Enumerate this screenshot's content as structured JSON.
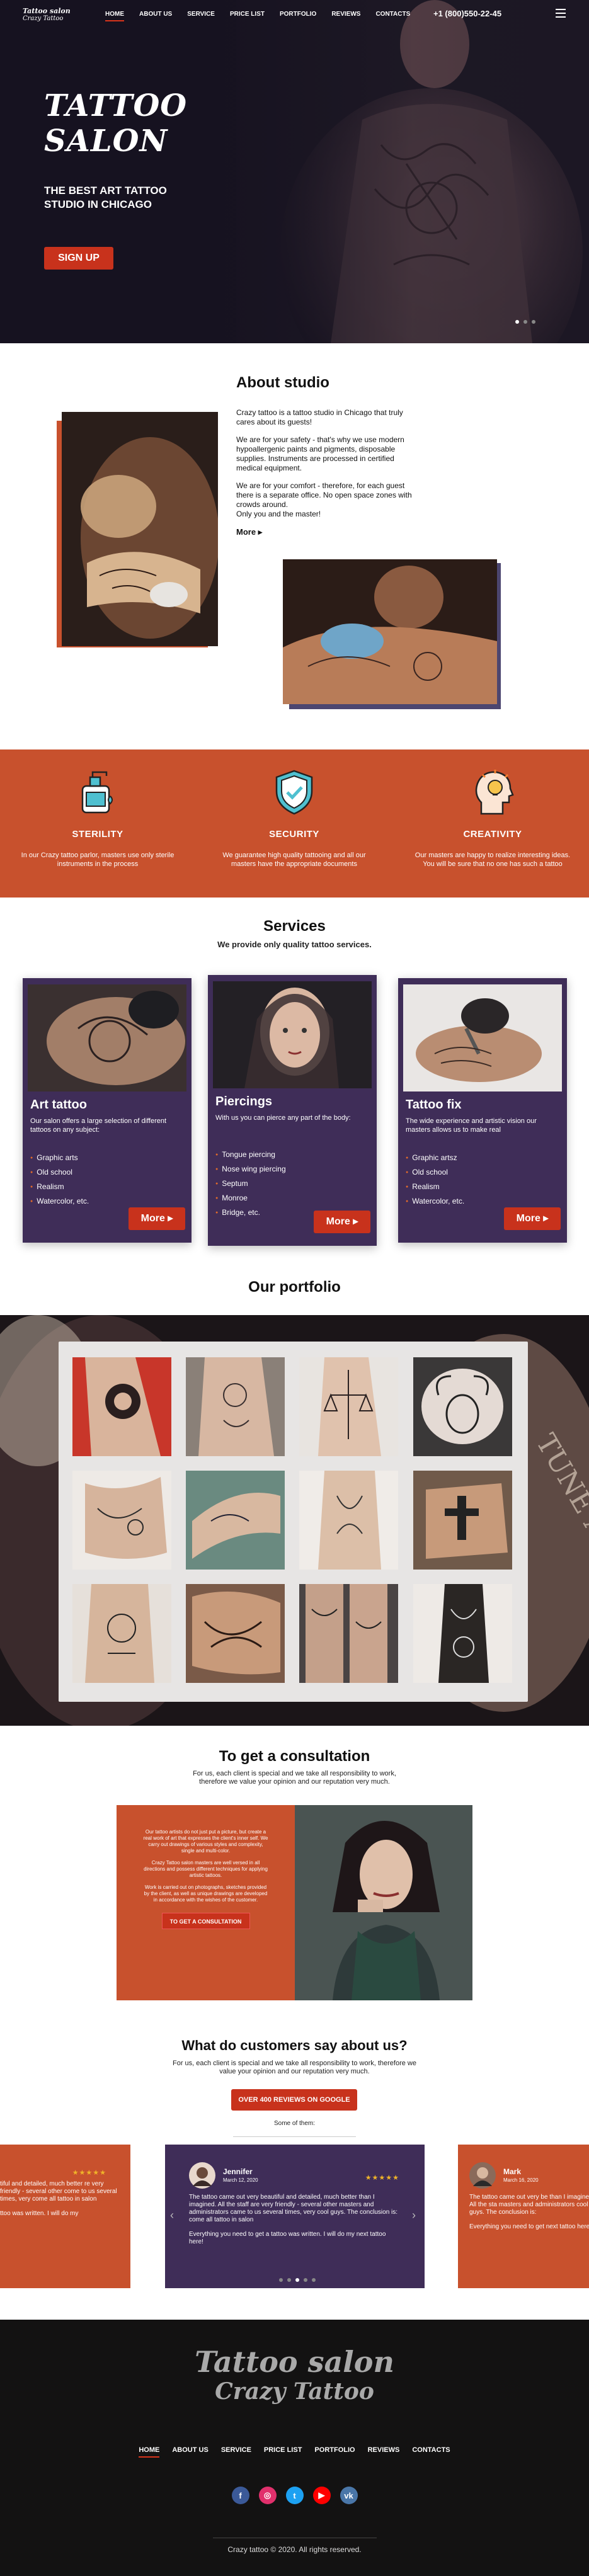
{
  "nav": {
    "logo_line1": "Tattoo salon",
    "logo_line2": "Crazy Tattoo",
    "links": [
      "HOME",
      "ABOUT US",
      "SERVICE",
      "PRICE LIST",
      "PORTFOLIO",
      "REVIEWS",
      "CONTACTS"
    ],
    "phone": "+1 (800)550-22-45"
  },
  "hero": {
    "title_line1": "TATTOO",
    "title_line2": "SALON",
    "subtitle": "THE BEST ART TATTOO STUDIO IN CHICAGO",
    "cta": "SIGN UP"
  },
  "about": {
    "title": "About studio",
    "p1": "Crazy tattoo is a tattoo studio in Chicago that truly cares about its guests!",
    "p2": "We are for your safety - that's why we use modern hypoallergenic paints and pigments, disposable supplies. Instruments are processed in certified medical equipment.",
    "p3a": "We are for your comfort - therefore, for each guest there is a separate office. No open space zones with crowds around.",
    "p3b": "Only you and the master!",
    "more": "More"
  },
  "features": [
    {
      "icon": "sterility-icon",
      "title": "STERILITY",
      "text": "In our Crazy tattoo parlor, masters use only sterile instruments in the process"
    },
    {
      "icon": "security-icon",
      "title": "SECURITY",
      "text": "We guarantee high quality tattooing and all our masters have the appropriate documents"
    },
    {
      "icon": "creativity-icon",
      "title": "CREATIVITY",
      "text": "Our masters are happy to realize interesting ideas. You will be sure that no one has such a tattoo"
    }
  ],
  "services": {
    "title": "Services",
    "subtitle": "We provide only quality tattoo services.",
    "cards": [
      {
        "title": "Art tattoo",
        "desc": "Our salon offers a large selection of different tattoos on any subject:",
        "items": [
          "Graphic arts",
          "Old school",
          "Realism",
          "Watercolor, etc."
        ],
        "btn": "More"
      },
      {
        "title": "Piercings",
        "desc": "With us you can pierce any part of the body:",
        "items": [
          "Tongue piercing",
          "Nose wing piercing",
          "Septum",
          "Monroe",
          "Bridge, etc."
        ],
        "btn": "More"
      },
      {
        "title": "Tattoo fix",
        "desc": "The wide experience and artistic vision our masters allows us to make real",
        "items": [
          "Graphic artsz",
          "Old school",
          "Realism",
          "Watercolor, etc."
        ],
        "btn": "More"
      }
    ]
  },
  "portfolio": {
    "title": "Our portfolio"
  },
  "consult": {
    "title": "To get a consultation",
    "subtitle": "For us, each client is special and we take all responsibility to work, therefore we value your opinion and our reputation very much.",
    "p1": "Our tattoo artists do not just put a picture, but create a real work of art that expresses the client's inner self. We carry out drawings of various styles and complexity, single and multi-color.",
    "p2": "Crazy Tattoo salon masters are well versed in all directions and possess different techniques for applying artistic tattoos.",
    "p3": "Work is carried out on photographs, sketches provided by the client, as well as unique drawings are developed in accordance with the wishes of the customer.",
    "btn": "TO GET A CONSULTATION"
  },
  "reviews": {
    "title": "What do customers say about us?",
    "subtitle": "For us, each client is special and we take all responsibility to work, therefore we value your opinion and our reputation very much.",
    "google_btn": "OVER 400 REVIEWS ON GOOGLE",
    "some": "Some of them:",
    "stars": "★★★★★",
    "left_partial": {
      "p1": "tiful and detailed, much better re very friendly - several other come to us several times, very come all tattoo in salon",
      "p2": "ttoo was written. I will do my"
    },
    "center": {
      "name": "Jennifer",
      "date": "March 12, 2020",
      "p1": "The tattoo came out very beautiful and detailed, much better than I imagined. All the staff are very friendly - several other masters and administrators came to us several times, very cool guys. The conclusion is: come all tattoo in salon",
      "p2": "Everything you need to get a tattoo was written. I will do my next tattoo here!"
    },
    "right_partial": {
      "name": "Mark",
      "date": "March 16, 2020",
      "p1": "The tattoo came out very be than I imagined. All the sta masters and administrators cool guys. The conclusion is:",
      "p2": "Everything you need to get next tattoo here!"
    },
    "prev": "‹",
    "next": "›"
  },
  "footer": {
    "logo_line1": "Tattoo salon",
    "logo_line2": "Crazy Tattoo",
    "links": [
      "HOME",
      "ABOUT US",
      "SERVICE",
      "PRICE LIST",
      "PORTFOLIO",
      "REVIEWS",
      "CONTACTS"
    ],
    "social": [
      {
        "name": "facebook-icon",
        "glyph": "f",
        "color": "#3b5998"
      },
      {
        "name": "instagram-icon",
        "glyph": "◎",
        "color": "#e1306c"
      },
      {
        "name": "twitter-icon",
        "glyph": "t",
        "color": "#1da1f2"
      },
      {
        "name": "youtube-icon",
        "glyph": "▶",
        "color": "#ff0000"
      },
      {
        "name": "vk-icon",
        "glyph": "vk",
        "color": "#4a76a8"
      }
    ],
    "copyright": "Crazy tattoo © 2020. All rights reserved."
  }
}
